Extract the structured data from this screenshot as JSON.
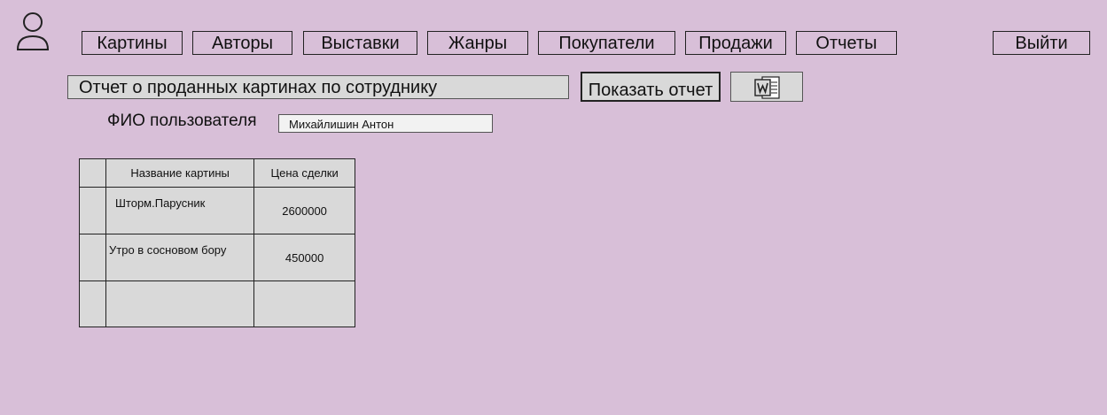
{
  "nav": {
    "items": [
      "Картины",
      "Авторы",
      "Выставки",
      "Жанры",
      "Покупатели",
      "Продажи",
      "Отчеты"
    ],
    "logout_label": "Выйти"
  },
  "report": {
    "selected": "Отчет о проданных картинах по сотруднику",
    "show_button_label": "Показать отчет",
    "export_icon": "word-export-icon"
  },
  "filter": {
    "label": "ФИО пользователя",
    "value": "Михайлишин Антон"
  },
  "table": {
    "columns": [
      "Название картины",
      "Цена сделки"
    ],
    "rows": [
      [
        "Шторм.Парусник",
        "2600000"
      ],
      [
        "Утро в сосновом бору",
        "450000"
      ],
      [
        "",
        ""
      ]
    ]
  }
}
